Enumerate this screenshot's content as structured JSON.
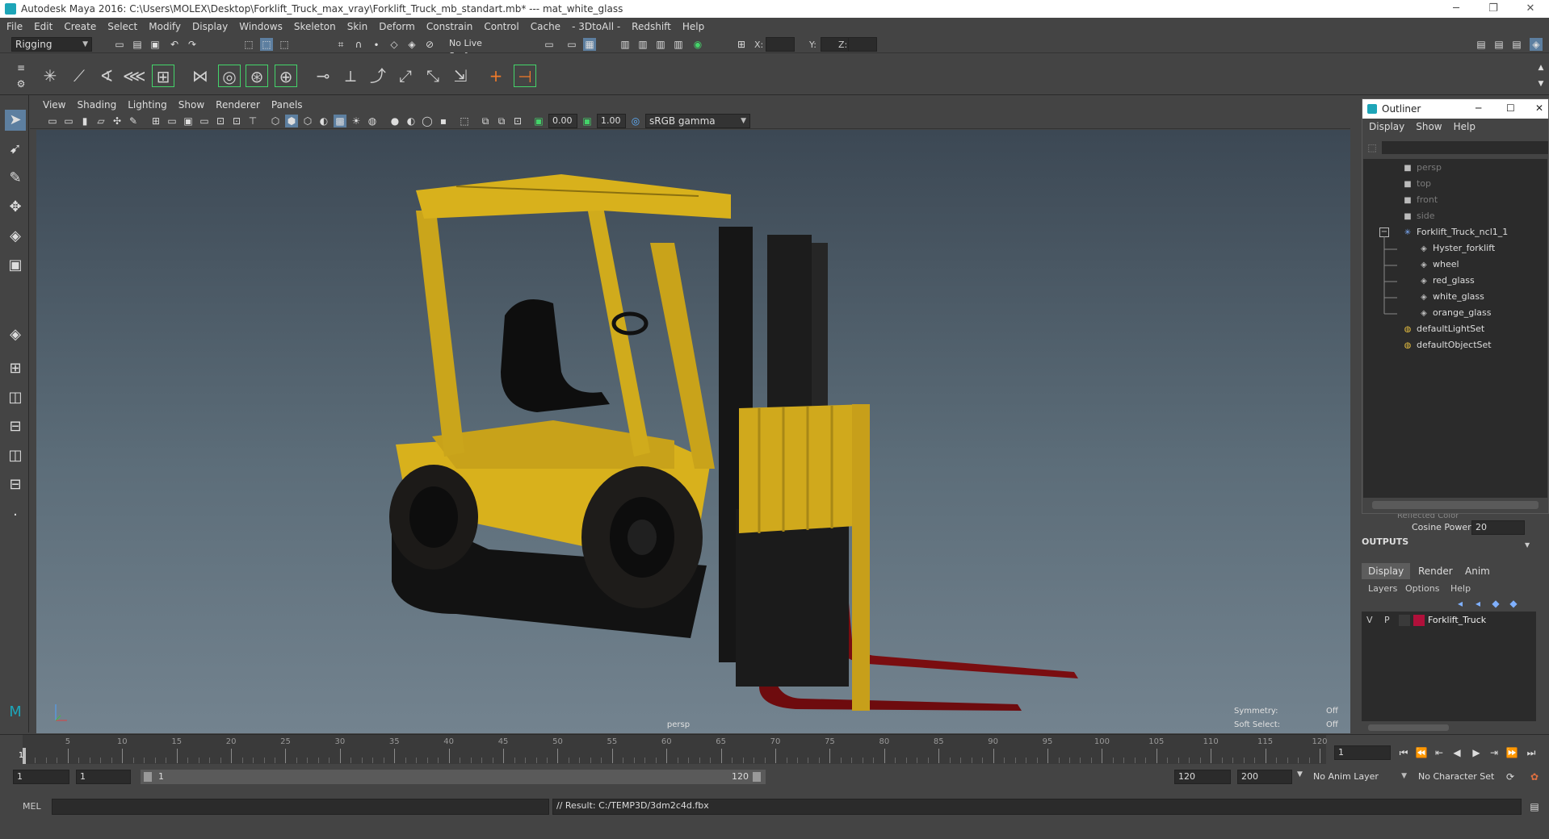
{
  "window": {
    "title": "Autodesk Maya 2016: C:\\Users\\MOLEX\\Desktop\\Forklift_Truck_max_vray\\Forklift_Truck_mb_standart.mb*   ---   mat_white_glass",
    "minimize": "─",
    "maximize": "❐",
    "close": "✕"
  },
  "menubar": [
    "File",
    "Edit",
    "Create",
    "Select",
    "Modify",
    "Display",
    "Windows",
    "Skeleton",
    "Skin",
    "Deform",
    "Constrain",
    "Control",
    "Cache",
    "- 3DtoAll -",
    "Redshift",
    "Help"
  ],
  "statusline": {
    "menu_set": "Rigging",
    "live_surface": "No Live Surface",
    "x_label": "X:",
    "y_label": "Y:",
    "z_label": "Z:"
  },
  "viewport": {
    "menus": [
      "View",
      "Shading",
      "Lighting",
      "Show",
      "Renderer",
      "Panels"
    ],
    "exposure": "0.00",
    "gamma": "1.00",
    "color_space": "sRGB gamma",
    "camera_label": "persp",
    "symmetry_label": "Symmetry:",
    "symmetry_value": "Off",
    "soft_select_label": "Soft Select:",
    "soft_select_value": "Off"
  },
  "outliner": {
    "title": "Outliner",
    "menus": [
      "Display",
      "Show",
      "Help"
    ],
    "items": [
      {
        "label": "persp",
        "icon": "camera-icon",
        "dim": true
      },
      {
        "label": "top",
        "icon": "camera-icon",
        "dim": true
      },
      {
        "label": "front",
        "icon": "camera-icon",
        "dim": true
      },
      {
        "label": "side",
        "icon": "camera-icon",
        "dim": true
      },
      {
        "label": "Forklift_Truck_ncl1_1",
        "icon": "group-icon",
        "dim": false
      },
      {
        "label": "Hyster_forklift",
        "icon": "mesh-icon",
        "dim": false
      },
      {
        "label": "wheel",
        "icon": "mesh-icon",
        "dim": false
      },
      {
        "label": "red_glass",
        "icon": "mesh-icon",
        "dim": false
      },
      {
        "label": "white_glass",
        "icon": "mesh-icon",
        "dim": false
      },
      {
        "label": "orange_glass",
        "icon": "mesh-icon",
        "dim": false
      },
      {
        "label": "defaultLightSet",
        "icon": "set-icon",
        "dim": false
      },
      {
        "label": "defaultObjectSet",
        "icon": "set-icon",
        "dim": false
      }
    ]
  },
  "attributes": {
    "cut_label": "Reflected Color",
    "cosine_power_label": "Cosine Power",
    "cosine_power_value": "20",
    "outputs_label": "OUTPUTS"
  },
  "layers": {
    "tabs": [
      "Display",
      "Render",
      "Anim"
    ],
    "menus": [
      "Layers",
      "Options",
      "Help"
    ],
    "row": {
      "v": "V",
      "p": "P",
      "name": "Forklift_Truck",
      "color": "#b0103a"
    }
  },
  "timeline": {
    "labels": [
      "5",
      "10",
      "15",
      "20",
      "25",
      "30",
      "35",
      "40",
      "45",
      "50",
      "55",
      "60",
      "65",
      "70",
      "75",
      "80",
      "85",
      "90",
      "95",
      "100",
      "105",
      "110",
      "115",
      "120"
    ],
    "current_frame_marker": "1",
    "current_frame": "1"
  },
  "range": {
    "start": "1",
    "playback_start": "1",
    "slider_start": "1",
    "slider_end": "120",
    "playback_end": "120",
    "end": "200",
    "anim_layer": "No Anim Layer",
    "character_set": "No Character Set"
  },
  "command": {
    "mode": "MEL",
    "result": "// Result: C:/TEMP3D/3dm2c4d.fbx"
  },
  "colors": {
    "accent": "#1da5b8",
    "body_yellow": "#d8b11c",
    "fork_red": "#7a0d10"
  }
}
